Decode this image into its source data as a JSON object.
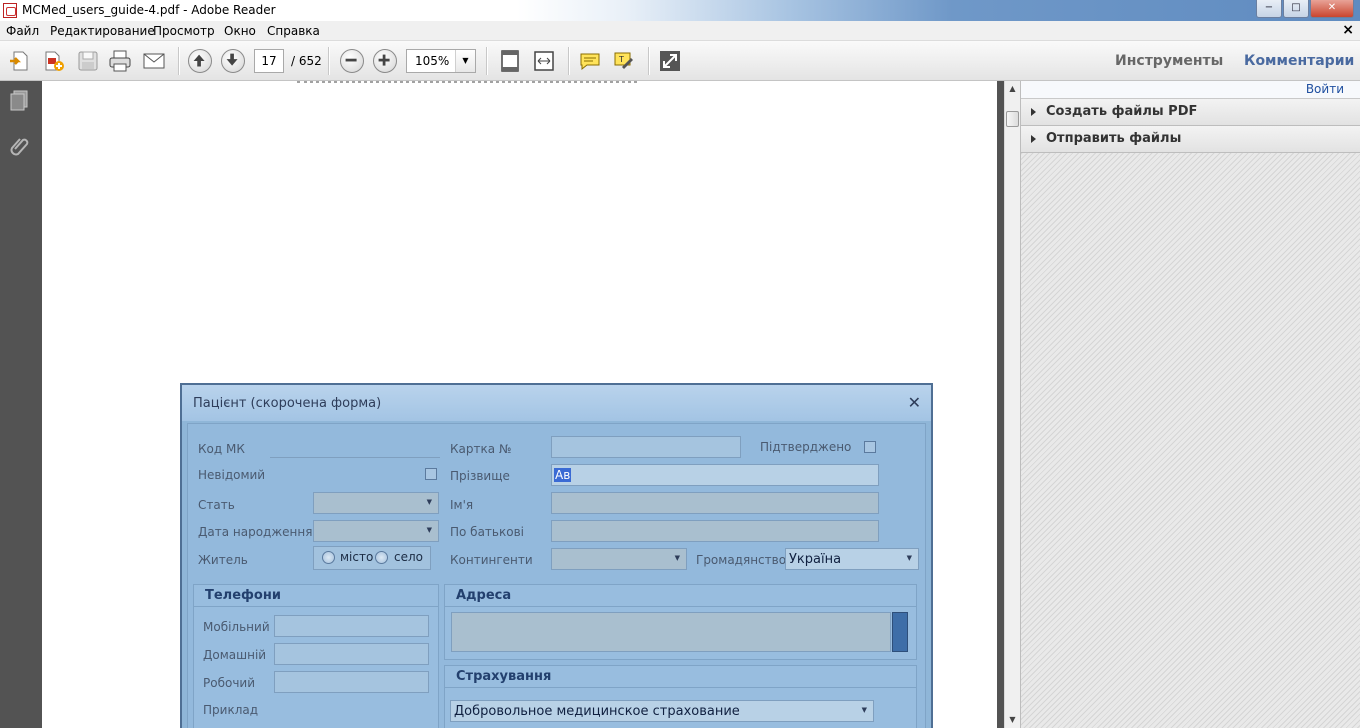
{
  "window": {
    "title": "MCMed_users_guide-4.pdf - Adobe Reader",
    "minimize": "−",
    "maximize": "□",
    "close": "✕",
    "doc_close": "×"
  },
  "menu": [
    "Файл",
    "Редактирование",
    "Просмотр",
    "Окно",
    "Справка"
  ],
  "toolbar": {
    "page_current": "17",
    "page_total": "/ 652",
    "zoom": "105%",
    "zoom_arrow": "▼",
    "tools_label": "Инструменты",
    "comments_label": "Комментарии"
  },
  "right_pane": {
    "sign_in": "Войти",
    "panels": [
      "Создать файлы PDF",
      "Отправить файлы"
    ]
  },
  "dialog": {
    "title": "Пацієнт (скорочена форма)",
    "close": "✕",
    "labels": {
      "code": "Код МК",
      "card": "Картка №",
      "confirmed": "Підтверджено",
      "unknown": "Невідомий",
      "surname": "Прізвище",
      "sex": "Стать",
      "name": "Ім'я",
      "birth": "Дата народження",
      "patronymic": "По батькові",
      "resident": "Житель",
      "city": "місто",
      "village": "село",
      "contingents": "Контингенти",
      "citizenship": "Громадянство"
    },
    "values": {
      "surname": "Ав",
      "citizenship": "Україна",
      "insurance": "Добровольное медицинское страхование"
    },
    "groups": {
      "phones": "Телефони",
      "address": "Адреса",
      "insurance": "Страхування"
    },
    "phones": [
      "Мобільний",
      "Домашній",
      "Робочий",
      "Приклад"
    ]
  }
}
